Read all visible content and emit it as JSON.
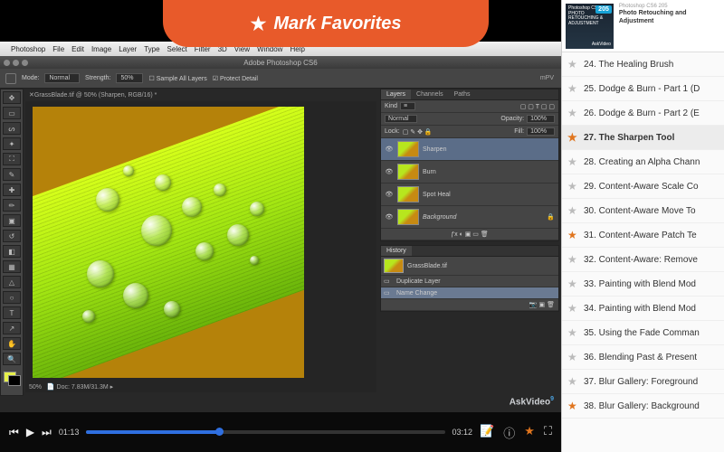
{
  "header": {
    "star": "★",
    "label": "Mark Favorites"
  },
  "menubar": {
    "apple": "",
    "items": [
      "Photoshop",
      "File",
      "Edit",
      "Image",
      "Layer",
      "Type",
      "Select",
      "Filter",
      "3D",
      "View",
      "Window",
      "Help"
    ]
  },
  "titlebar": "Adobe Photoshop CS6",
  "optbar": {
    "mode_label": "Mode:",
    "mode": "Normal",
    "strength_label": "Strength:",
    "strength": "50%",
    "sample": "Sample All Layers",
    "protect": "Protect Detail",
    "brand": "mPV"
  },
  "doc_tab": "GrassBlade.tif @ 50% (Sharpen, RGB/16) *",
  "canvas_status": {
    "zoom": "50%",
    "doc": "Doc: 7.83M/31.3M"
  },
  "layers_panel": {
    "tabs": [
      "Layers",
      "Channels",
      "Paths"
    ],
    "kind": "Kind",
    "blend": "Normal",
    "opacity_l": "Opacity:",
    "opacity": "100%",
    "lock_l": "Lock:",
    "fill_l": "Fill:",
    "fill": "100%",
    "layers": [
      {
        "name": "Sharpen",
        "sel": true,
        "bg": false
      },
      {
        "name": "Burn",
        "sel": false,
        "bg": false
      },
      {
        "name": "Spot Heal",
        "sel": false,
        "bg": false
      },
      {
        "name": "Background",
        "sel": false,
        "bg": true
      }
    ]
  },
  "history_panel": {
    "tab": "History",
    "file": "GrassBlade.tif",
    "items": [
      "Duplicate Layer",
      "Name Change"
    ]
  },
  "askvideo": "AskVideo",
  "player": {
    "cur": "01:13",
    "dur": "03:12",
    "progress_pct": 37
  },
  "course": {
    "badge": "205",
    "cover_line1": "Photoshop CS6",
    "cover_line2": "PHOTO RETOUCHING & ADJUSTMENT",
    "meta_top": "Photoshop CS6 205",
    "meta_title": "Photo Retouching and Adjustment",
    "ask": "AskVideo"
  },
  "lessons": [
    {
      "n": 24,
      "t": "The Healing Brush",
      "m": false
    },
    {
      "n": 25,
      "t": "Dodge & Burn - Part 1 (D",
      "m": false
    },
    {
      "n": 26,
      "t": "Dodge & Burn - Part 2 (E",
      "m": false
    },
    {
      "n": 27,
      "t": "The Sharpen Tool",
      "m": true,
      "sel": true
    },
    {
      "n": 28,
      "t": "Creating an Alpha Chann",
      "m": false
    },
    {
      "n": 29,
      "t": "Content-Aware Scale Co",
      "m": false
    },
    {
      "n": 30,
      "t": "Content-Aware Move To",
      "m": false
    },
    {
      "n": 31,
      "t": "Content-Aware Patch Te",
      "m": true
    },
    {
      "n": 32,
      "t": "Content-Aware: Remove",
      "m": false
    },
    {
      "n": 33,
      "t": "Painting with Blend Mod",
      "m": false
    },
    {
      "n": 34,
      "t": "Painting with Blend Mod",
      "m": false
    },
    {
      "n": 35,
      "t": "Using the Fade Comman",
      "m": false
    },
    {
      "n": 36,
      "t": "Blending Past & Present",
      "m": false
    },
    {
      "n": 37,
      "t": "Blur Gallery: Foreground",
      "m": false
    },
    {
      "n": 38,
      "t": "Blur Gallery: Background",
      "m": true
    }
  ]
}
